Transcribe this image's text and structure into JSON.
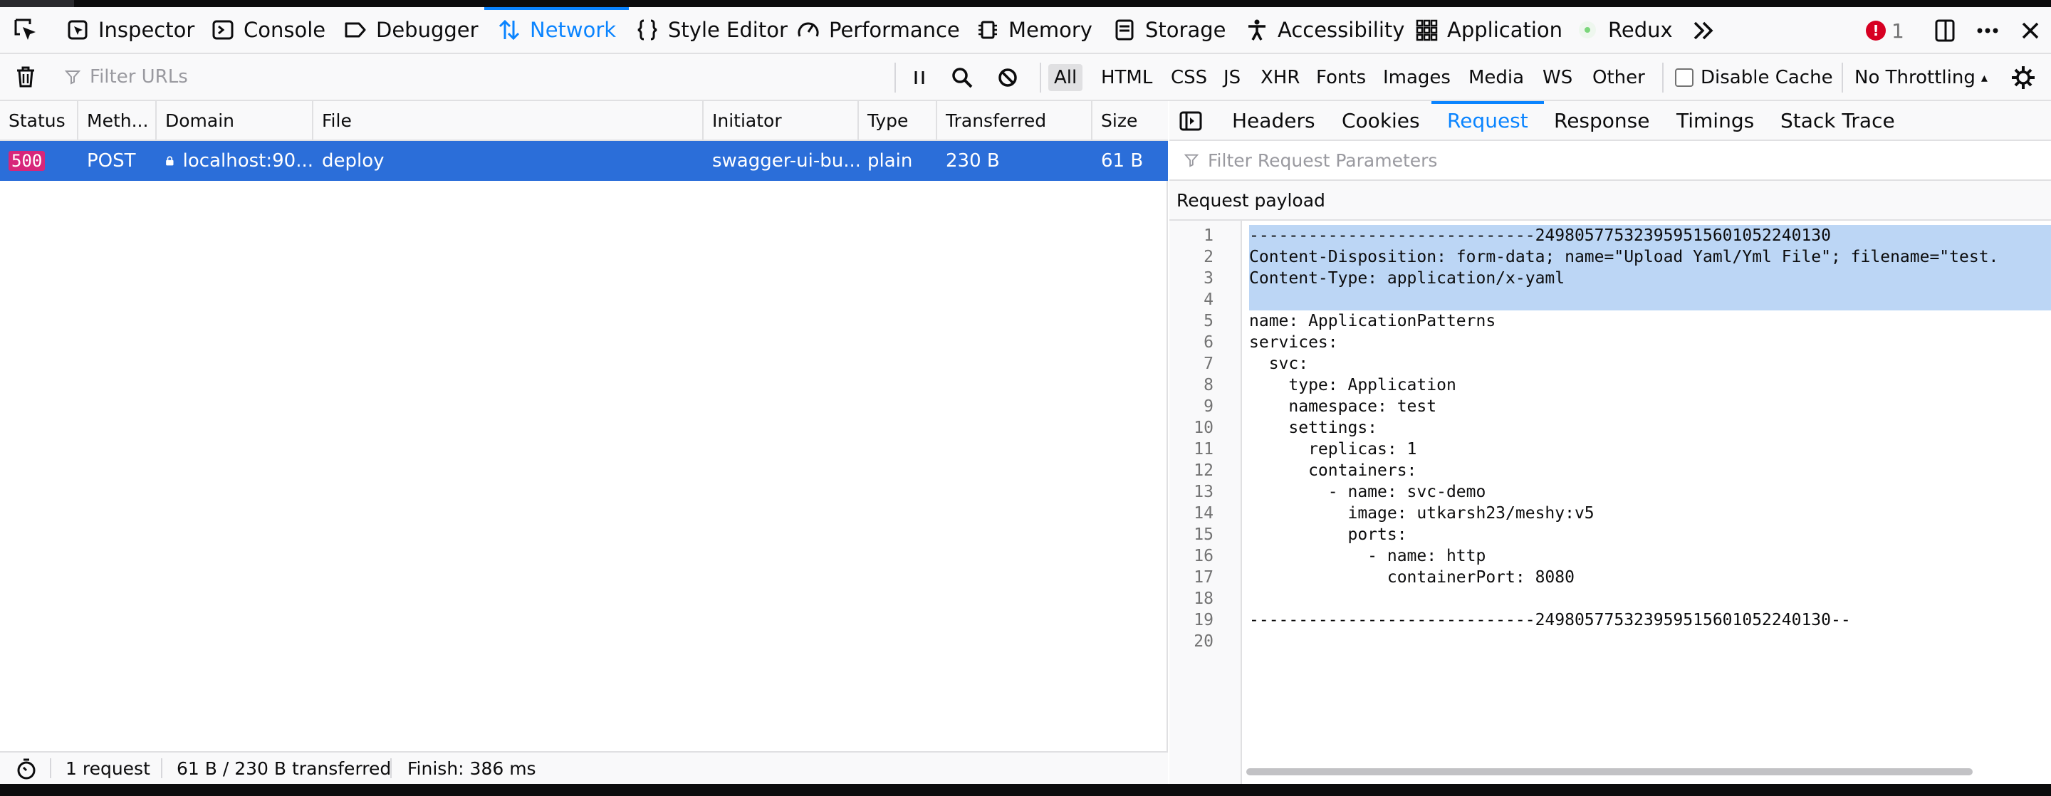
{
  "toolbar": {
    "tabs": [
      {
        "label": "Inspector",
        "icon": "inspector-icon"
      },
      {
        "label": "Console",
        "icon": "console-icon"
      },
      {
        "label": "Debugger",
        "icon": "debugger-icon"
      },
      {
        "label": "Network",
        "icon": "network-icon",
        "selected": true
      },
      {
        "label": "Style Editor",
        "icon": "style-editor-icon"
      },
      {
        "label": "Performance",
        "icon": "performance-icon"
      },
      {
        "label": "Memory",
        "icon": "memory-icon"
      },
      {
        "label": "Storage",
        "icon": "storage-icon"
      },
      {
        "label": "Accessibility",
        "icon": "accessibility-icon"
      },
      {
        "label": "Application",
        "icon": "application-icon"
      },
      {
        "label": "Redux",
        "icon": "redux-icon"
      }
    ],
    "error_count": "1"
  },
  "filterbar": {
    "filter_placeholder": "Filter URLs",
    "types": [
      "All",
      "HTML",
      "CSS",
      "JS",
      "XHR",
      "Fonts",
      "Images",
      "Media",
      "WS",
      "Other"
    ],
    "selected_type": "All",
    "disable_cache_label": "Disable Cache",
    "throttling": "No Throttling"
  },
  "table": {
    "columns": [
      "Status",
      "Meth...",
      "Domain",
      "File",
      "Initiator",
      "Type",
      "Transferred",
      "Size"
    ],
    "rows": [
      {
        "status": "500",
        "method": "POST",
        "domain": "localhost:90...",
        "file": "deploy",
        "initiator": "swagger-ui-bu...",
        "type": "plain",
        "transferred": "230 B",
        "size": "61 B"
      }
    ]
  },
  "summary": {
    "requests": "1 request",
    "transferred": "61 B / 230 B transferred",
    "finish": "Finish: 386 ms"
  },
  "details": {
    "tabs": [
      "Headers",
      "Cookies",
      "Request",
      "Response",
      "Timings",
      "Stack Trace"
    ],
    "selected_tab": "Request",
    "param_filter_placeholder": "Filter Request Parameters",
    "payload_title": "Request payload",
    "lines": [
      "-----------------------------249805775323959515601052240130",
      "Content-Disposition: form-data; name=\"Upload Yaml/Yml File\"; filename=\"test.",
      "Content-Type: application/x-yaml",
      "",
      "name: ApplicationPatterns",
      "services:",
      "  svc:",
      "    type: Application",
      "    namespace: test",
      "    settings:",
      "      replicas: 1",
      "      containers:",
      "        - name: svc-demo",
      "          image: utkarsh23/meshy:v5",
      "          ports:",
      "            - name: http",
      "              containerPort: 8080",
      "",
      "-----------------------------249805775323959515601052240130--",
      ""
    ],
    "selected_lines": [
      1,
      2,
      3,
      4
    ]
  },
  "colors": {
    "accent": "#0a84ff",
    "row_selected": "#2b6ed9",
    "status_error": "#d7267a",
    "selection": "#bcd6f5"
  }
}
